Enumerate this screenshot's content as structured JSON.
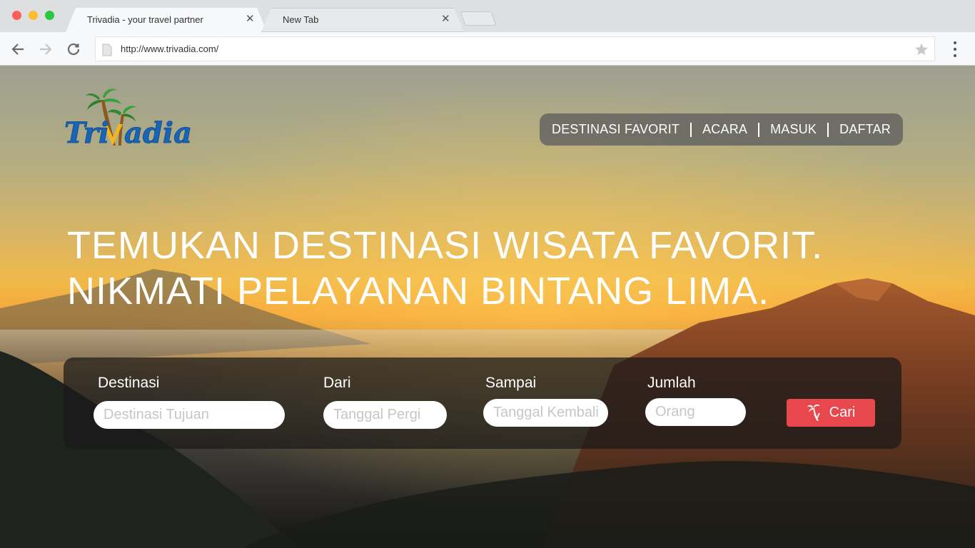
{
  "browser": {
    "tabs": [
      {
        "title": "Trivadia - your travel partner",
        "active": true
      },
      {
        "title": "New Tab",
        "active": false
      }
    ],
    "url": "http://www.trivadia.com/"
  },
  "logo": {
    "text_part1": "Tri",
    "text_part2": "adia",
    "brand_color": "#1a64b8",
    "accent_color": "#f2b523"
  },
  "nav": {
    "items": [
      "DESTINASI FAVORIT",
      "ACARA",
      "MASUK",
      "DAFTAR"
    ]
  },
  "hero": {
    "line1": "TEMUKAN DESTINASI WISATA FAVORIT.",
    "line2": "NIKMATI PELAYANAN BINTANG LIMA."
  },
  "search": {
    "destinasi": {
      "label": "Destinasi",
      "placeholder": "Destinasi Tujuan"
    },
    "dari": {
      "label": "Dari",
      "placeholder": "Tanggal Pergi"
    },
    "sampai": {
      "label": "Sampai",
      "placeholder": "Tanggal Kembali"
    },
    "jumlah": {
      "label": "Jumlah",
      "placeholder": "Orang"
    },
    "button_label": "Cari",
    "button_color": "#e8474e"
  },
  "icons": {
    "back": "arrow-left-icon",
    "forward": "arrow-right-icon",
    "reload": "reload-icon",
    "page": "page-icon",
    "bookmark": "star-icon",
    "menu": "menu-dots-icon",
    "search_button": "palm-tree-icon"
  }
}
